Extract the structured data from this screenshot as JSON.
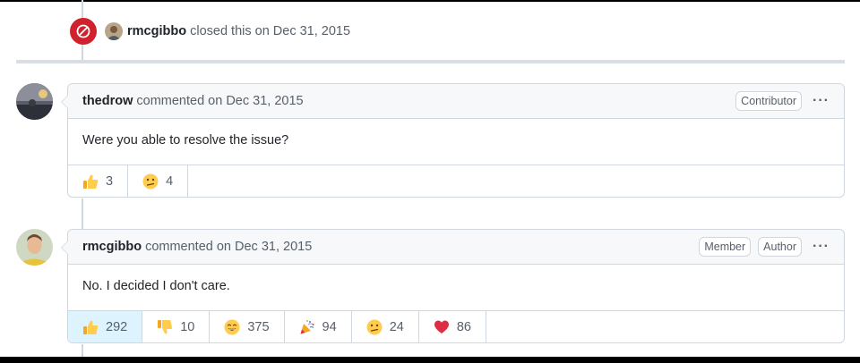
{
  "closed_event": {
    "actor": "rmcgibbo",
    "action": "closed this on Dec 31, 2015",
    "icon": "closed-circle-icon",
    "badge_color": "#cf222e"
  },
  "comments": [
    {
      "author": "thedrow",
      "meta": "commented on Dec 31, 2015",
      "roles": [
        "Contributor"
      ],
      "body": "Were you able to resolve the issue?",
      "reactions": [
        {
          "emoji": "thumbs-up",
          "count": "3"
        },
        {
          "emoji": "confused",
          "count": "4"
        }
      ]
    },
    {
      "author": "rmcgibbo",
      "meta": "commented on Dec 31, 2015",
      "roles": [
        "Member",
        "Author"
      ],
      "body": "No. I decided I don't care.",
      "reactions": [
        {
          "emoji": "thumbs-up",
          "count": "292"
        },
        {
          "emoji": "thumbs-down",
          "count": "10"
        },
        {
          "emoji": "laugh",
          "count": "375"
        },
        {
          "emoji": "hooray",
          "count": "94"
        },
        {
          "emoji": "confused",
          "count": "24"
        },
        {
          "emoji": "heart",
          "count": "86"
        }
      ]
    }
  ],
  "colors": {
    "accent_reaction_bg": "#ddf4ff",
    "border": "#d0d7de",
    "header_bg": "#f6f8fa"
  }
}
